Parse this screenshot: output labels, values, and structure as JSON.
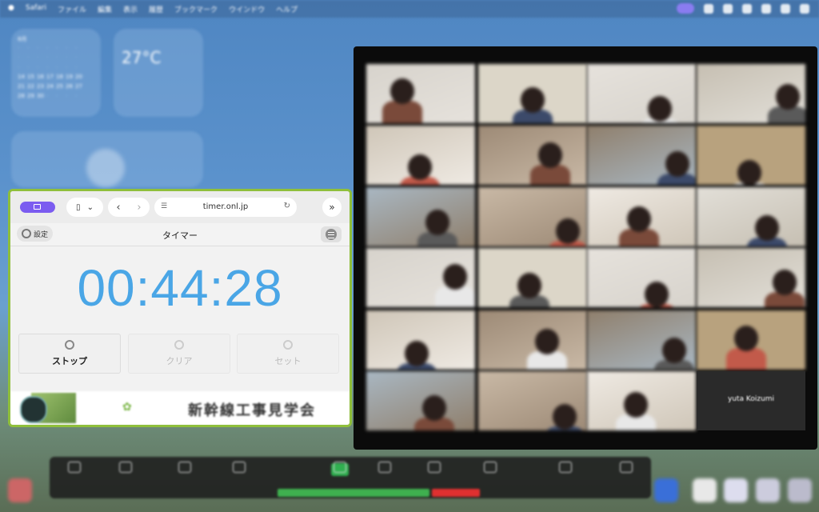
{
  "menubar": {
    "items": [
      "Safari",
      "ファイル",
      "編集",
      "表示",
      "履歴",
      "ブックマーク",
      "ウインドウ",
      "ヘルプ"
    ]
  },
  "calendar_widget": {
    "month": "8月",
    "rows": [
      [
        "",
        "",
        "",
        "",
        "",
        "",
        ""
      ],
      [
        "",
        "",
        "",
        "",
        "",
        "",
        ""
      ],
      [
        "",
        "",
        "",
        "",
        "",
        "",
        ""
      ],
      [
        "14",
        "15",
        "16",
        "17",
        "18",
        "19",
        "20"
      ],
      [
        "21",
        "22",
        "23",
        "24",
        "25",
        "26",
        "27"
      ],
      [
        "28",
        "29",
        "30",
        "",
        "",
        "",
        ""
      ]
    ]
  },
  "weather_widget": {
    "temp": "27°C"
  },
  "browser": {
    "url": "timer.onl.jp",
    "page_title": "タイマー",
    "settings_label": "設定",
    "timer_value": "00:44:28",
    "buttons": {
      "stop": "ストップ",
      "clear": "クリア",
      "set": "セット"
    },
    "banner_text": "新幹線工事見学会"
  },
  "video_grid": {
    "name_tile_label": "yuta Koizumi"
  },
  "colors": {
    "timer": "#4aa6e6",
    "window_border": "#8fbf3b",
    "accent_purple": "#7b5cf0"
  }
}
